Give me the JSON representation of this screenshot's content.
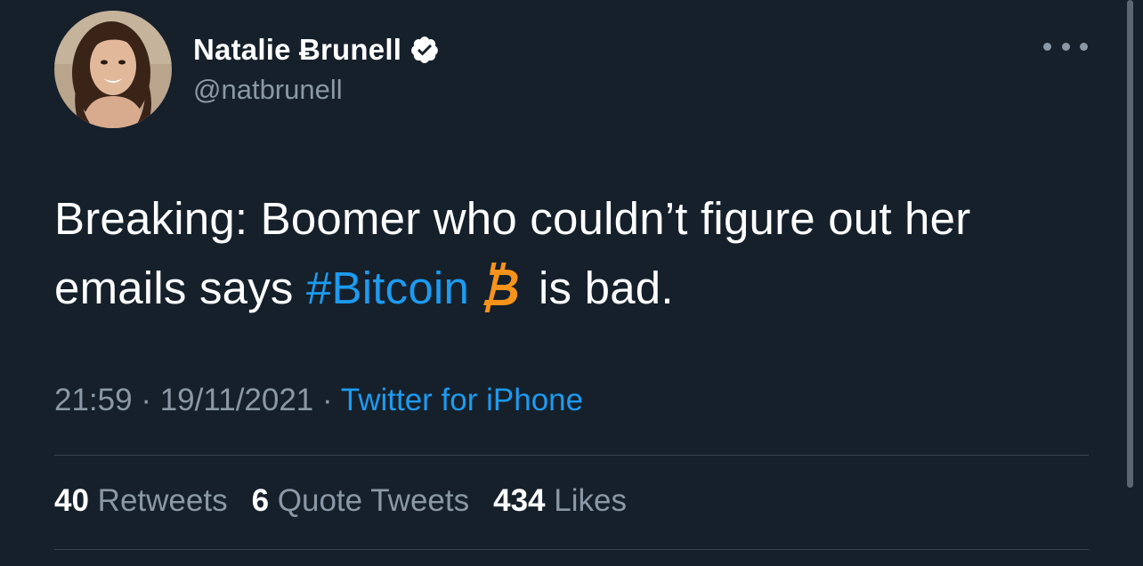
{
  "author": {
    "display_name": "Natalie Ƀrunell",
    "handle": "@natbrunell",
    "verified": true,
    "avatar_icon": "profile-photo"
  },
  "tweet": {
    "text_part1": "Breaking: Boomer who couldn’t figure out her emails says ",
    "hashtag": "#Bitcoin",
    "emoji_icon": "bitcoin-icon",
    "text_part2": "is bad.",
    "time": "21:59",
    "date": "19/11/2021",
    "separator": " · ",
    "source": "Twitter for iPhone"
  },
  "stats": {
    "retweets_count": "40",
    "retweets_label": "Retweets",
    "quotes_count": "6",
    "quotes_label": "Quote Tweets",
    "likes_count": "434",
    "likes_label": "Likes"
  },
  "colors": {
    "background": "#15202b",
    "link": "#1d9bf0",
    "secondary_text": "#8b98a5",
    "bitcoin_orange": "#f7931a"
  }
}
